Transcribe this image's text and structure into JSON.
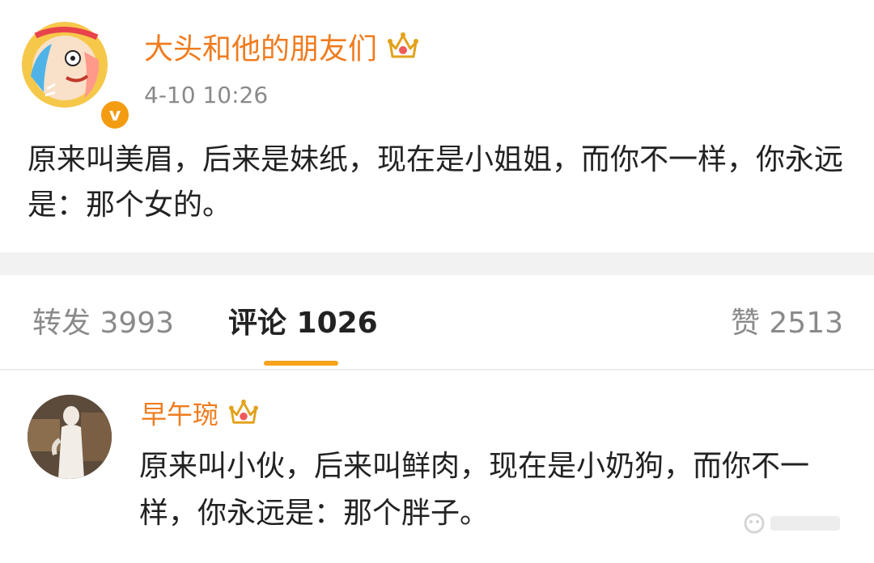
{
  "post": {
    "author": "大头和他的朋友们",
    "timestamp": "4-10 10:26",
    "text": "原来叫美眉，后来是妹纸，现在是小姐姐，而你不一样，你永远是：那个女的。",
    "avatar_badge": "v",
    "author_crown_icon": "vip-crown-icon"
  },
  "tabs": {
    "repost": "转发 3993",
    "comment": "评论 1026",
    "like": "赞 2513",
    "active": "comment"
  },
  "comment": {
    "author": "早午琬",
    "text": "原来叫小伙，后来叫鲜肉，现在是小奶狗，而你不一样，你永远是：那个胖子。",
    "author_crown_icon": "vip-crown-icon"
  },
  "colors": {
    "accent": "#f07c1f",
    "tab_underline": "#f7a21b",
    "text": "#222222",
    "muted": "#8a8a8a"
  }
}
